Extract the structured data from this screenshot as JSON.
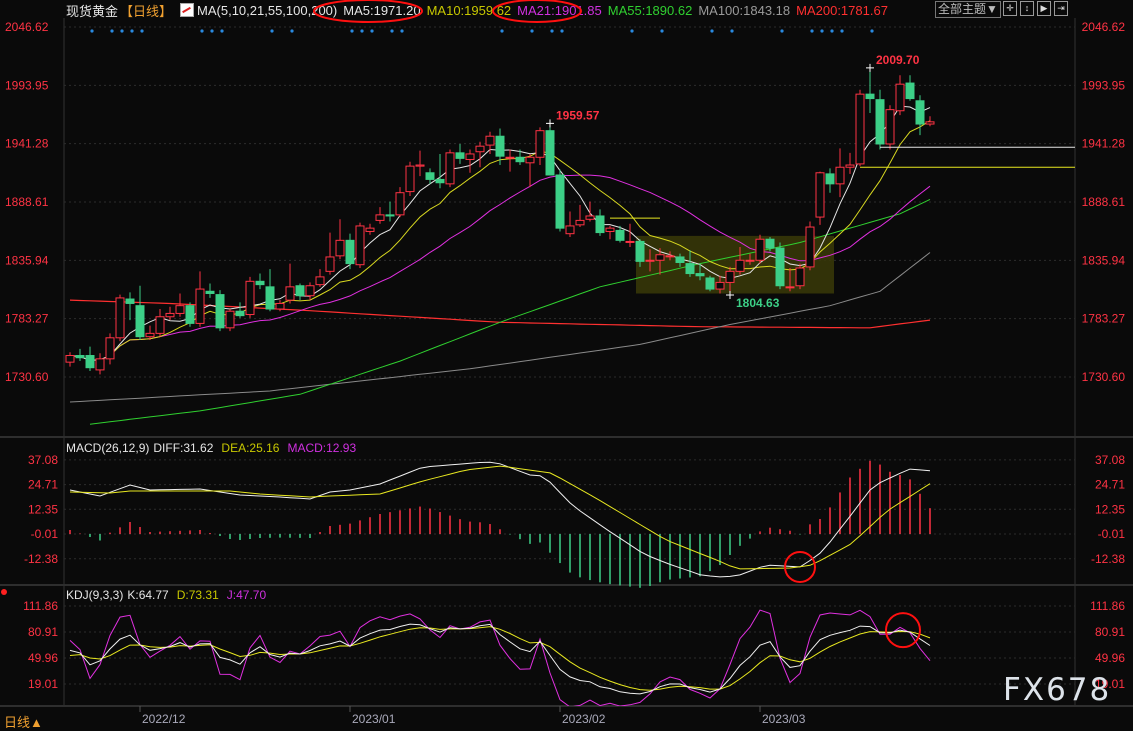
{
  "header": {
    "symbol": "现货黄金",
    "period": "【日线】",
    "ma_params": "MA(5,10,21,55,100,200)",
    "ma5": "MA5:1971.20",
    "ma10": "MA10:1959.62",
    "ma21": "MA21:1901.85",
    "ma55": "MA55:1890.62",
    "ma100": "MA100:1843.18",
    "ma200": "MA200:1781.67",
    "theme_button": "全部主题▼",
    "tool_icons": [
      "crosshair-icon",
      "fit-vertical-icon",
      "play-icon",
      "exit-icon"
    ]
  },
  "macd_header": {
    "params": "MACD(26,12,9)",
    "diff": "DIFF:31.62",
    "dea": "DEA:25.16",
    "macd": "MACD:12.93"
  },
  "kdj_header": {
    "params": "KDJ(9,3,3)",
    "k": "K:64.77",
    "d": "D:73.31",
    "j": "J:47.70"
  },
  "footer": {
    "period": "日线▲",
    "watermark": "FX678"
  },
  "colors": {
    "up": "#ff3344",
    "down": "#3ccf87",
    "ma5": "#e6e6e6",
    "ma10": "#d8d820",
    "ma21": "#e030e0",
    "ma55": "#30d030",
    "ma100": "#8a8a8a",
    "ma200": "#ff3030",
    "axis_label": "#ff3344",
    "annotation": "#ff1010",
    "signal_dot": "#2a8ae0"
  },
  "chart_data": {
    "type": "candlestick",
    "title": "现货黄金 日线",
    "x_ticks": [
      {
        "index": 7,
        "label": "2022/12"
      },
      {
        "index": 28,
        "label": "2023/01"
      },
      {
        "index": 49,
        "label": "2023/02"
      },
      {
        "index": 69,
        "label": "2023/03"
      }
    ],
    "price_ticks": [
      "2046.62",
      "1993.95",
      "1941.28",
      "1888.61",
      "1835.94",
      "1783.27",
      "1730.60"
    ],
    "price_range": [
      1730.6,
      2046.62
    ],
    "candles_ohlc": [
      [
        1744,
        1753,
        1740,
        1750
      ],
      [
        1750,
        1756,
        1745,
        1748
      ],
      [
        1750,
        1758,
        1736,
        1739
      ],
      [
        1737,
        1752,
        1733,
        1747
      ],
      [
        1747,
        1770,
        1742,
        1766
      ],
      [
        1766,
        1805,
        1763,
        1802
      ],
      [
        1801,
        1807,
        1782,
        1797
      ],
      [
        1795,
        1813,
        1764,
        1767
      ],
      [
        1767,
        1777,
        1764,
        1770
      ],
      [
        1770,
        1792,
        1767,
        1785
      ],
      [
        1785,
        1794,
        1782,
        1788
      ],
      [
        1788,
        1806,
        1785,
        1795
      ],
      [
        1795,
        1798,
        1776,
        1779
      ],
      [
        1779,
        1826,
        1776,
        1810
      ],
      [
        1808,
        1815,
        1802,
        1806
      ],
      [
        1805,
        1809,
        1772,
        1775
      ],
      [
        1775,
        1792,
        1772,
        1790
      ],
      [
        1790,
        1798,
        1784,
        1786
      ],
      [
        1787,
        1821,
        1784,
        1817
      ],
      [
        1817,
        1824,
        1810,
        1814
      ],
      [
        1812,
        1828,
        1790,
        1792
      ],
      [
        1792,
        1800,
        1790,
        1797
      ],
      [
        1800,
        1833,
        1797,
        1812
      ],
      [
        1813,
        1815,
        1800,
        1804
      ],
      [
        1804,
        1816,
        1800,
        1813
      ],
      [
        1814,
        1828,
        1812,
        1821
      ],
      [
        1826,
        1861,
        1823,
        1839
      ],
      [
        1840,
        1873,
        1837,
        1854
      ],
      [
        1854,
        1860,
        1828,
        1833
      ],
      [
        1832,
        1870,
        1829,
        1867
      ],
      [
        1862,
        1869,
        1859,
        1865
      ],
      [
        1872,
        1884,
        1869,
        1877
      ],
      [
        1877,
        1889,
        1871,
        1876
      ],
      [
        1877,
        1902,
        1875,
        1897
      ],
      [
        1898,
        1925,
        1894,
        1921
      ],
      [
        1921,
        1935,
        1912,
        1922
      ],
      [
        1915,
        1919,
        1905,
        1909
      ],
      [
        1909,
        1932,
        1901,
        1906
      ],
      [
        1905,
        1936,
        1902,
        1933
      ],
      [
        1933,
        1941,
        1923,
        1928
      ],
      [
        1927,
        1936,
        1915,
        1932
      ],
      [
        1934,
        1943,
        1920,
        1939
      ],
      [
        1940,
        1952,
        1932,
        1948
      ],
      [
        1948,
        1955,
        1922,
        1930
      ],
      [
        1929,
        1936,
        1916,
        1929
      ],
      [
        1929,
        1936,
        1922,
        1925
      ],
      [
        1924,
        1932,
        1902,
        1929
      ],
      [
        1929,
        1956,
        1922,
        1953
      ],
      [
        1953,
        1959.57,
        1913,
        1913
      ],
      [
        1913,
        1918,
        1862,
        1865
      ],
      [
        1860,
        1880,
        1857,
        1867
      ],
      [
        1868,
        1886,
        1866,
        1872
      ],
      [
        1873,
        1889,
        1871,
        1876
      ],
      [
        1876,
        1882,
        1858,
        1861
      ],
      [
        1862,
        1867,
        1855,
        1865
      ],
      [
        1863,
        1867,
        1852,
        1854
      ],
      [
        1853,
        1869,
        1848,
        1853
      ],
      [
        1853,
        1855,
        1830,
        1835
      ],
      [
        1836,
        1846,
        1826,
        1836
      ],
      [
        1836,
        1847,
        1823,
        1841
      ],
      [
        1840,
        1844,
        1836,
        1840
      ],
      [
        1839,
        1842,
        1830,
        1834
      ],
      [
        1833,
        1845,
        1821,
        1824
      ],
      [
        1824,
        1833,
        1818,
        1822
      ],
      [
        1820,
        1822,
        1808,
        1810
      ],
      [
        1810,
        1822,
        1806,
        1816
      ],
      [
        1816,
        1830,
        1804.63,
        1826
      ],
      [
        1826,
        1848,
        1823,
        1836
      ],
      [
        1836,
        1842,
        1832,
        1836
      ],
      [
        1836,
        1859,
        1833,
        1855
      ],
      [
        1855,
        1857,
        1844,
        1847
      ],
      [
        1847,
        1852,
        1810,
        1813
      ],
      [
        1812,
        1829,
        1808,
        1812
      ],
      [
        1813,
        1833,
        1810,
        1829
      ],
      [
        1830,
        1871,
        1827,
        1866
      ],
      [
        1875,
        1916,
        1868,
        1915
      ],
      [
        1914,
        1919,
        1897,
        1905
      ],
      [
        1905,
        1937,
        1893,
        1920
      ],
      [
        1920,
        1933,
        1914,
        1922
      ],
      [
        1923,
        1990,
        1921,
        1986
      ],
      [
        1986,
        2009.7,
        1969,
        1982
      ],
      [
        1981,
        1990,
        1936,
        1941
      ],
      [
        1941,
        1976,
        1936,
        1972
      ],
      [
        1971,
        2003,
        1967,
        1995
      ],
      [
        1996,
        2003,
        1980,
        1982
      ],
      [
        1980,
        1985,
        1949,
        1959
      ],
      [
        1959,
        1966,
        1957,
        1961
      ]
    ],
    "ma55_series": [
      [
        2,
        1688
      ],
      [
        13,
        1700
      ],
      [
        23,
        1715
      ],
      [
        33,
        1745
      ],
      [
        43,
        1780
      ],
      [
        53,
        1812
      ],
      [
        63,
        1833
      ],
      [
        73,
        1852
      ],
      [
        83,
        1878
      ],
      [
        86,
        1891
      ]
    ],
    "ma100_series": [
      [
        0,
        1708
      ],
      [
        20,
        1718
      ],
      [
        40,
        1738
      ],
      [
        57,
        1760
      ],
      [
        66,
        1778
      ],
      [
        76,
        1795
      ],
      [
        81,
        1808
      ],
      [
        86,
        1843
      ]
    ],
    "ma200_series": [
      [
        0,
        1800
      ],
      [
        10,
        1797
      ],
      [
        23,
        1791
      ],
      [
        43,
        1780
      ],
      [
        63,
        1776
      ],
      [
        80,
        1775
      ],
      [
        86,
        1782
      ]
    ],
    "price_labels": [
      {
        "index": 48,
        "value": "1959.57",
        "kind": "high"
      },
      {
        "index": 66,
        "value": "1804.63",
        "kind": "low"
      },
      {
        "index": 80,
        "value": "2009.70",
        "kind": "high"
      }
    ],
    "horizontal_lines": [
      {
        "price": 1938,
        "from_index": 81,
        "color": "#e6e6e6"
      },
      {
        "price": 1920,
        "from_index": 79,
        "color": "#e8e820"
      },
      {
        "price": 1874,
        "from_index": 54,
        "to_index": 59,
        "color": "#e8e820"
      }
    ],
    "range_box": {
      "from_index": 57,
      "to_index": 76,
      "price_top": 1858,
      "price_bottom": 1806
    },
    "signal_markers": [
      2,
      4,
      5,
      6,
      7,
      13,
      14,
      15,
      20,
      22,
      28,
      29,
      30,
      32,
      33,
      43,
      46,
      48,
      49,
      56,
      59,
      64,
      66,
      71,
      74,
      75,
      76,
      77,
      80
    ],
    "macd": {
      "ticks": [
        "37.08",
        "24.71",
        "12.35",
        "-0.01",
        "-12.38"
      ],
      "diff_series": [
        [
          0,
          22
        ],
        [
          3,
          19
        ],
        [
          6,
          24.5
        ],
        [
          8,
          22
        ],
        [
          13,
          22.5
        ],
        [
          17,
          19.5
        ],
        [
          21,
          18.5
        ],
        [
          24,
          17.5
        ],
        [
          26,
          21
        ],
        [
          28,
          22
        ],
        [
          31,
          25
        ],
        [
          35.3,
          33.5
        ],
        [
          41.7,
          36
        ],
        [
          42.8,
          35.5
        ],
        [
          46,
          29.5
        ],
        [
          47.4,
          29
        ],
        [
          50.3,
          14
        ],
        [
          53.9,
          1.5
        ],
        [
          57.4,
          -10
        ],
        [
          59.6,
          -14.5
        ],
        [
          63.1,
          -20.5
        ],
        [
          64.9,
          -21.5
        ],
        [
          66.7,
          -21
        ],
        [
          69.6,
          -15.5
        ],
        [
          73.1,
          -16.5
        ],
        [
          75.3,
          -8.5
        ],
        [
          78.1,
          9.5
        ],
        [
          80.3,
          24
        ],
        [
          83.9,
          32.5
        ],
        [
          86,
          31.62
        ]
      ],
      "dea_series": [
        [
          0,
          21
        ],
        [
          4,
          20.5
        ],
        [
          6,
          21.5
        ],
        [
          16,
          21.5
        ],
        [
          19,
          20
        ],
        [
          24,
          18.5
        ],
        [
          26,
          19
        ],
        [
          31,
          20
        ],
        [
          35.3,
          26.5
        ],
        [
          39.6,
          32
        ],
        [
          43.1,
          34
        ],
        [
          48.1,
          30.5
        ],
        [
          52.4,
          18.5
        ],
        [
          59.6,
          -3
        ],
        [
          64.9,
          -13.5
        ],
        [
          66.7,
          -17.5
        ],
        [
          72.1,
          -17
        ],
        [
          74.2,
          -15.5
        ],
        [
          78.1,
          -5
        ],
        [
          81.7,
          11.5
        ],
        [
          86,
          25.16
        ]
      ],
      "annotation_circle_index": 73
    },
    "kdj": {
      "ticks": [
        "111.86",
        "80.91",
        "49.96",
        "19.01"
      ],
      "annotation_circle_index": 83
    }
  }
}
